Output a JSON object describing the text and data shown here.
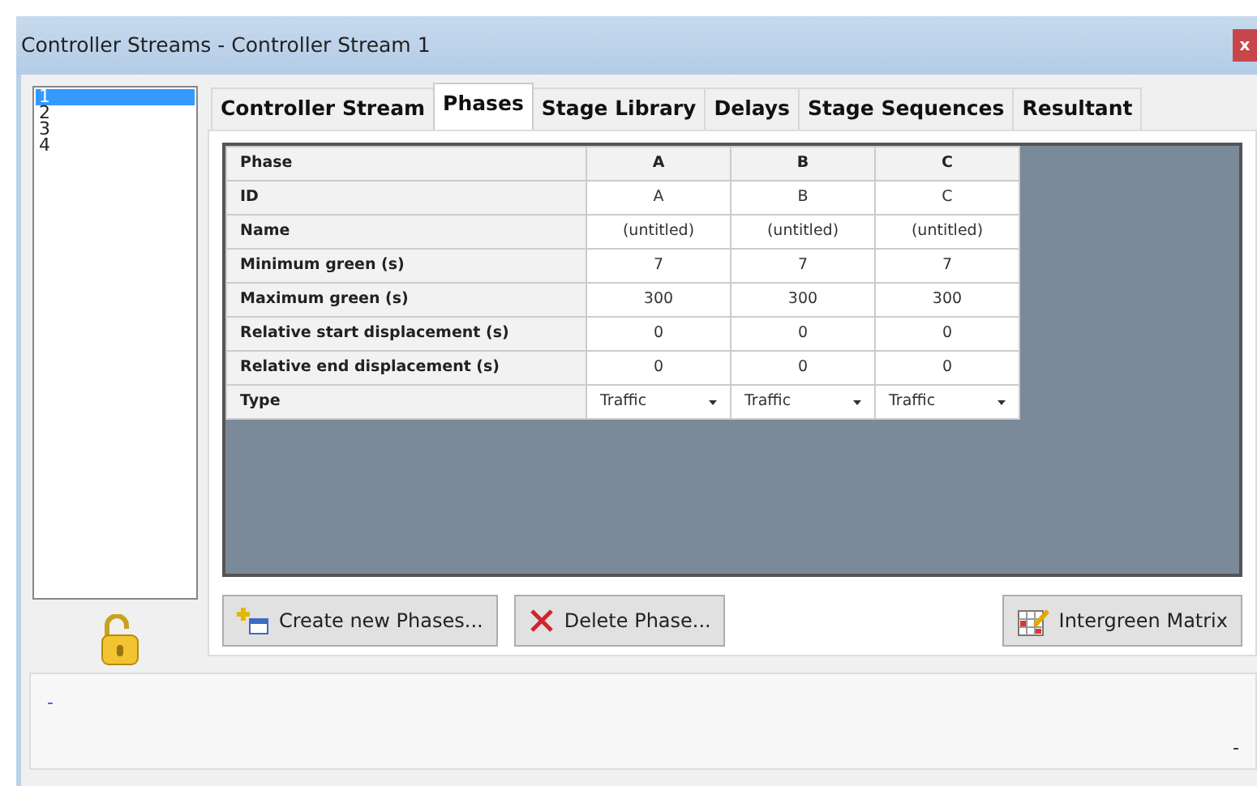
{
  "window": {
    "title": "Controller Streams - Controller Stream 1",
    "close": "x"
  },
  "streams": [
    {
      "label": "1",
      "selected": true
    },
    {
      "label": "2",
      "selected": false
    },
    {
      "label": "3",
      "selected": false
    },
    {
      "label": "4",
      "selected": false
    }
  ],
  "tabs": [
    {
      "label": "Controller Stream",
      "selected": false
    },
    {
      "label": "Phases",
      "selected": true
    },
    {
      "label": "Stage Library",
      "selected": false
    },
    {
      "label": "Delays",
      "selected": false
    },
    {
      "label": "Stage Sequences",
      "selected": false
    },
    {
      "label": "Resultant",
      "selected": false
    }
  ],
  "table": {
    "columns": [
      "Phase",
      "A",
      "B",
      "C"
    ],
    "rows": [
      {
        "kind": "text",
        "cells": [
          "ID",
          "A",
          "B",
          "C"
        ]
      },
      {
        "kind": "text",
        "cells": [
          "Name",
          "(untitled)",
          "(untitled)",
          "(untitled)"
        ]
      },
      {
        "kind": "text",
        "cells": [
          "Minimum green (s)",
          "7",
          "7",
          "7"
        ]
      },
      {
        "kind": "text",
        "cells": [
          "Maximum green (s)",
          "300",
          "300",
          "300"
        ]
      },
      {
        "kind": "text",
        "cells": [
          "Relative start displacement (s)",
          "0",
          "0",
          "0"
        ]
      },
      {
        "kind": "text",
        "cells": [
          "Relative end displacement (s)",
          "0",
          "0",
          "0"
        ]
      },
      {
        "kind": "dropdown",
        "cells": [
          "Type",
          "Traffic",
          "Traffic",
          "Traffic"
        ]
      }
    ]
  },
  "buttons": [
    {
      "label": "Create new Phases...",
      "kind": "create"
    },
    {
      "label": "Delete Phase...",
      "kind": "delete"
    },
    {
      "label": "Intergreen Matrix",
      "kind": "matrix"
    }
  ],
  "status": {
    "message": "-",
    "corner": "-"
  }
}
